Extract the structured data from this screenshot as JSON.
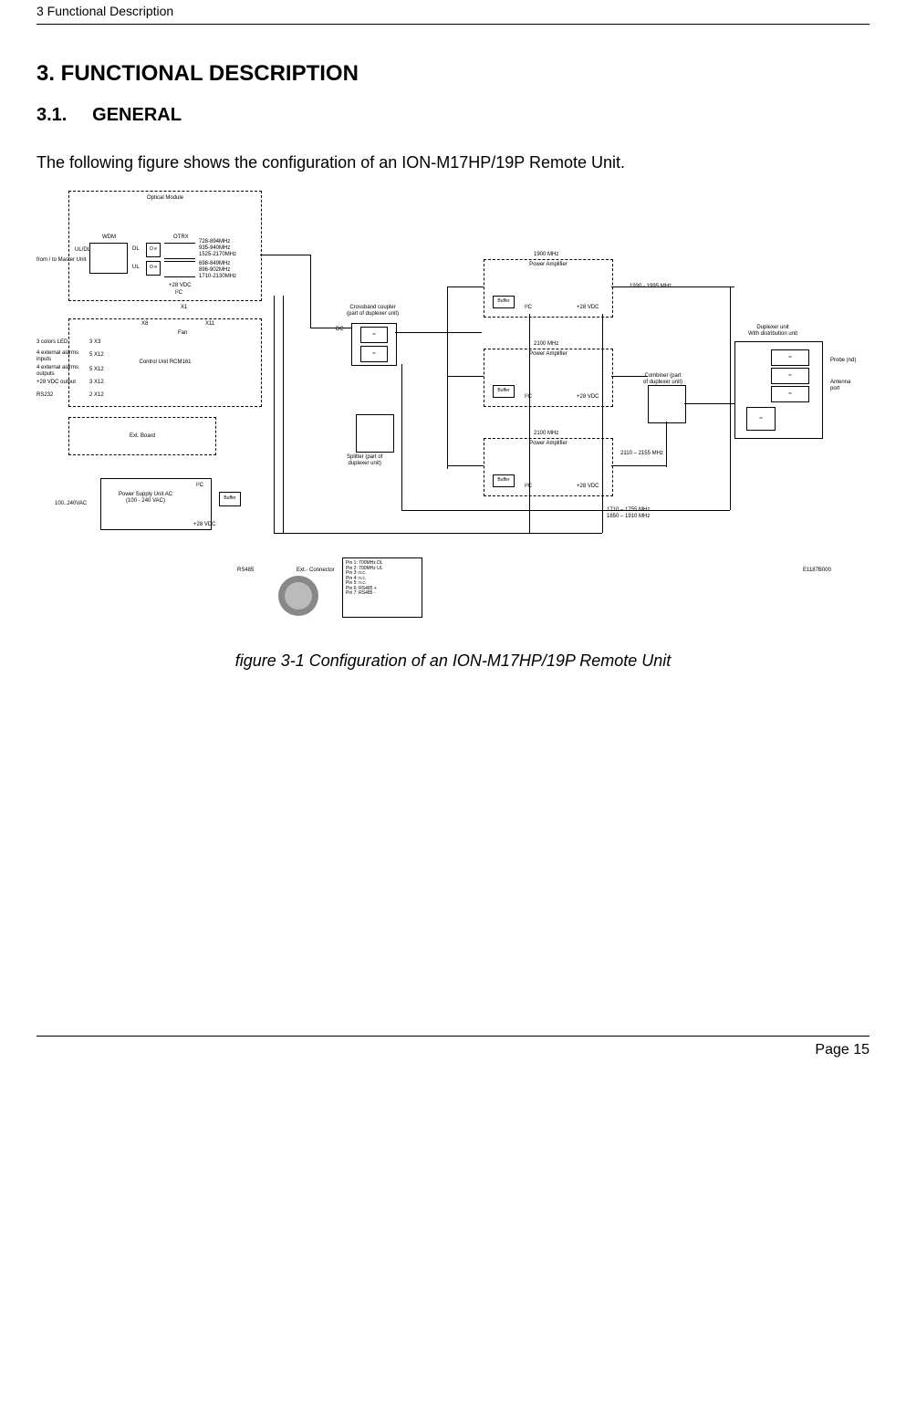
{
  "header": {
    "breadcrumb": "3 Functional Description"
  },
  "chapter": {
    "num_title": "3. FUNCTIONAL DESCRIPTION"
  },
  "section": {
    "num": "3.1.",
    "title": "GENERAL"
  },
  "intro": "The following figure shows the configuration of an ION-M17HP/19P Remote Unit.",
  "caption": "figure 3-1 Configuration of an ION-M17HP/19P Remote Unit",
  "footer": {
    "page": "Page 15"
  },
  "diagram": {
    "optical_module": {
      "title": "Optical Module",
      "wdm": "WDM",
      "otrx": "OTRX",
      "uldl": "UL/DL",
      "dl": "DL",
      "ul": "UL",
      "o_e": "O\ne",
      "master": "from / to Master Unit",
      "freqs": [
        "728-894MHz",
        "935-940MHz",
        "1525-2170MHz",
        "698-849MHz",
        "896-902MHz",
        "1710-2130MHz"
      ],
      "vdc": "+28 VDC",
      "i2c": "I²C",
      "x1": "X1"
    },
    "control_unit": {
      "title": "Control Unit RCM161",
      "fan": "Fan",
      "x8": "X8",
      "x11": "X11",
      "rows": [
        {
          "left": "3 colors LED",
          "right": "X3",
          "count": "3"
        },
        {
          "left": "4 external alarms\ninputs",
          "right": "X12",
          "count": "5"
        },
        {
          "left": "4 external alarms\noutputs",
          "right": "X12",
          "count": "5"
        },
        {
          "left": "+28 VDC output",
          "right": "X12",
          "count": "3"
        },
        {
          "left": "RS232",
          "right": "X12",
          "count": "2"
        }
      ]
    },
    "ext_board": "Ext. Board",
    "psu": {
      "title": "Power Supply Unit  AC\n(100 - 240 VAC)",
      "in": "100..240VAC",
      "i2c": "I²C",
      "buf": "Buffer",
      "vdc": "+28 VDC"
    },
    "rs485": "RS485",
    "ext_conn": {
      "label": "Ext.- Connector",
      "pins": "Pin 1: 700MHz DL\nPin 2: 700MHz UL\nPin 3: n.c.\nPin 4: n.c.\nPin 5: n.c.\nPin 6: RS485 +\nPin 7: RS485 -"
    },
    "crossband": "Crossband coupler\n(part of duplexer unit)",
    "dc": "DC",
    "splitter": "Splitter (part of\nduplexer unit)",
    "pa1900": {
      "band": "1900 MHz",
      "title": "Power Amplifier",
      "buf": "Buffer",
      "i2c": "I²C",
      "vdc": "+28 VDC"
    },
    "pa2100a": {
      "band": "2100 MHz",
      "title": "Power Amplifier",
      "buf": "Buffer",
      "i2c": "I²C",
      "vdc": "+28 VDC"
    },
    "pa2100b": {
      "band": "2100 MHz",
      "title": "Power Amplifier",
      "buf": "Buffer",
      "i2c": "I²C",
      "vdc": "+28 VDC"
    },
    "freq_1930": "1930 - 1995 MHz",
    "combiner": "Combiner (part\nof duplexer unit)",
    "freq_2110": "2110 – 2155 MHz",
    "freq_1710": "1710 – 1755 MHz\n1850 – 1910 MHz",
    "duplexer": "Duplexer unit\nWith distribution unit",
    "probe": "Probe (nd)",
    "antenna": "Antenna\nport",
    "doc_id": "E1187B000"
  }
}
